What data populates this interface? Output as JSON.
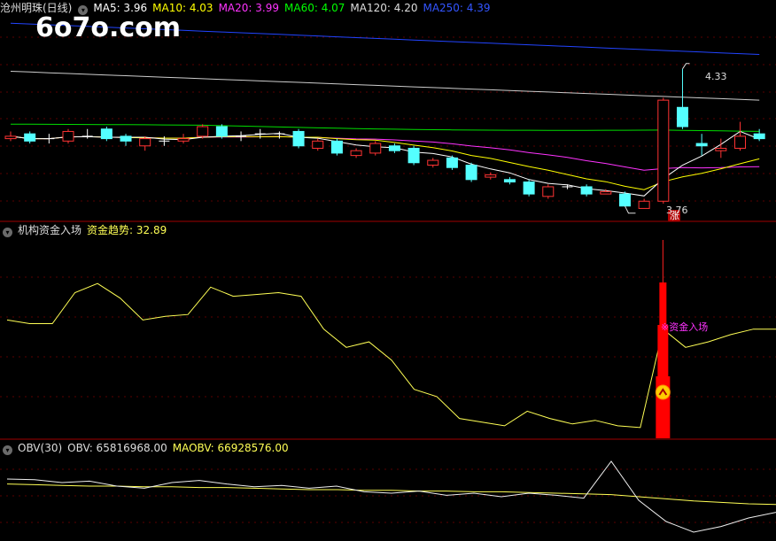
{
  "watermark": "6o7o.com",
  "panel_main": {
    "title": "沧州明珠(日线)",
    "ma_labels": [
      {
        "text": "MA5: 3.96",
        "color": "#ffffff"
      },
      {
        "text": "MA10: 4.03",
        "color": "#ffff00"
      },
      {
        "text": "MA20: 3.99",
        "color": "#ff33ff"
      },
      {
        "text": "MA60: 4.07",
        "color": "#00ff00"
      },
      {
        "text": "MA120: 4.20",
        "color": "#dddddd"
      },
      {
        "text": "MA250: 4.39",
        "color": "#3355ff"
      }
    ],
    "high_label": "4.33",
    "low_label": "3.76",
    "zhang_badge": "涨"
  },
  "panel_fund": {
    "title": "机构资金入场",
    "trend_label": "资金趋势: 32.89",
    "annotation": "※资金入场",
    "colors": {
      "trend": "#ffff55",
      "signal": "#ff0000",
      "annotation": "#ff33ff"
    }
  },
  "panel_obv": {
    "title": "OBV(30)",
    "obv_label": "OBV: 65816968.00",
    "maobv_label": "MAOBV: 66928576.00"
  },
  "chart_data": [
    {
      "type": "candlestick",
      "name": "沧州明珠(日线)",
      "ylim": [
        3.7,
        4.55
      ],
      "last_values": {
        "MA5": 3.96,
        "MA10": 4.03,
        "MA20": 3.99,
        "MA60": 4.07,
        "MA120": 4.2,
        "MA250": 4.39
      },
      "high": 4.33,
      "low": 3.76,
      "candles": [
        [
          4.04,
          4.05,
          4.07,
          4.03
        ],
        [
          4.06,
          4.03,
          4.07,
          4.02
        ],
        [
          4.04,
          4.04,
          4.06,
          4.02
        ],
        [
          4.03,
          4.07,
          4.08,
          4.02
        ],
        [
          4.05,
          4.05,
          4.08,
          4.04
        ],
        [
          4.08,
          4.04,
          4.09,
          4.03
        ],
        [
          4.05,
          4.03,
          4.06,
          4.01
        ],
        [
          4.01,
          4.04,
          4.05,
          3.99
        ],
        [
          4.03,
          4.03,
          4.05,
          4.01
        ],
        [
          4.03,
          4.04,
          4.06,
          4.02
        ],
        [
          4.05,
          4.09,
          4.1,
          4.04
        ],
        [
          4.09,
          4.05,
          4.1,
          4.04
        ],
        [
          4.05,
          4.05,
          4.07,
          4.03
        ],
        [
          4.06,
          4.06,
          4.08,
          4.04
        ],
        [
          4.06,
          4.06,
          4.07,
          4.04
        ],
        [
          4.07,
          4.01,
          4.08,
          4.0
        ],
        [
          4.0,
          4.03,
          4.04,
          3.99
        ],
        [
          4.03,
          3.98,
          4.04,
          3.97
        ],
        [
          3.97,
          3.99,
          4.0,
          3.96
        ],
        [
          3.98,
          4.02,
          4.03,
          3.97
        ],
        [
          4.01,
          3.99,
          4.02,
          3.98
        ],
        [
          4.0,
          3.94,
          4.01,
          3.93
        ],
        [
          3.93,
          3.95,
          3.96,
          3.92
        ],
        [
          3.96,
          3.92,
          3.97,
          3.91
        ],
        [
          3.93,
          3.87,
          3.94,
          3.86
        ],
        [
          3.88,
          3.89,
          3.9,
          3.87
        ],
        [
          3.87,
          3.86,
          3.88,
          3.85
        ],
        [
          3.86,
          3.81,
          3.87,
          3.8
        ],
        [
          3.8,
          3.84,
          3.85,
          3.79
        ],
        [
          3.84,
          3.84,
          3.85,
          3.83
        ],
        [
          3.84,
          3.81,
          3.85,
          3.8
        ],
        [
          3.81,
          3.82,
          3.83,
          3.81
        ],
        [
          3.81,
          3.76,
          3.82,
          3.76
        ],
        [
          3.75,
          3.78,
          3.79,
          3.75
        ],
        [
          3.78,
          4.2,
          4.21,
          3.77
        ],
        [
          4.17,
          4.09,
          4.33,
          4.08
        ],
        [
          4.02,
          4.01,
          4.06,
          3.97
        ],
        [
          3.99,
          4.0,
          4.04,
          3.96
        ],
        [
          4.0,
          4.05,
          4.11,
          3.99
        ],
        [
          4.06,
          4.04,
          4.08,
          4.03
        ]
      ]
    },
    {
      "type": "line+bar",
      "name": "机构资金入场",
      "series": [
        {
          "name": "资金趋势",
          "values": [
            60,
            58,
            58,
            75,
            80,
            72,
            60,
            62,
            63,
            78,
            73,
            74,
            75,
            73,
            55,
            45,
            48,
            38,
            22,
            18,
            6,
            4,
            2,
            10,
            6,
            3,
            5,
            2,
            1,
            55,
            45,
            48,
            52,
            55,
            55
          ]
        },
        {
          "name": "资金入场",
          "signal_index": 29,
          "value": 92
        }
      ],
      "last_value": 32.89
    },
    {
      "type": "line",
      "name": "OBV(30)",
      "series": [
        {
          "name": "OBV",
          "values": [
            70.5,
            70.4,
            70.0,
            70.2,
            69.5,
            69.2,
            70.0,
            70.3,
            69.8,
            69.4,
            69.6,
            69.2,
            69.5,
            68.7,
            68.5,
            68.8,
            68.2,
            68.5,
            68.0,
            68.5,
            68.2,
            67.8,
            73.0,
            67.5,
            64.5,
            63.0,
            63.8,
            65.0,
            65.8
          ]
        },
        {
          "name": "MAOBV",
          "values": [
            69.8,
            69.7,
            69.6,
            69.5,
            69.5,
            69.4,
            69.4,
            69.3,
            69.3,
            69.2,
            69.1,
            69.0,
            69.0,
            68.9,
            68.9,
            68.8,
            68.8,
            68.7,
            68.7,
            68.6,
            68.5,
            68.4,
            68.3,
            68.0,
            67.7,
            67.4,
            67.2,
            67.0,
            66.9
          ]
        }
      ],
      "last_values": {
        "OBV": 65816968.0,
        "MAOBV": 66928576.0
      }
    }
  ]
}
